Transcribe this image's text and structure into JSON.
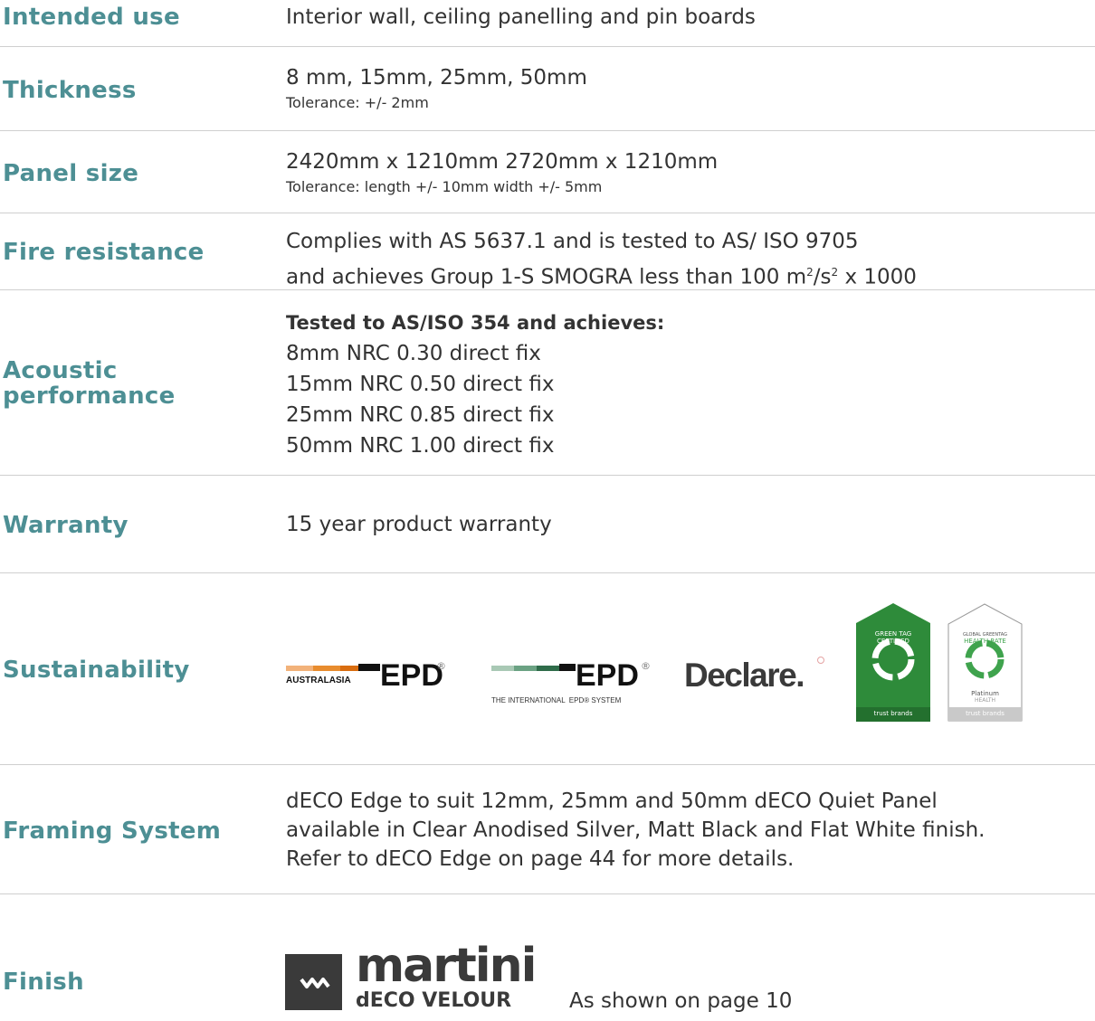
{
  "rows": {
    "intended_use": {
      "label": "Intended use",
      "value": "Interior wall, ceiling panelling and pin boards"
    },
    "thickness": {
      "label": "Thickness",
      "value": "8 mm, 15mm, 25mm, 50mm",
      "note": "Tolerance: +/- 2mm"
    },
    "panel_size": {
      "label": "Panel size",
      "value": "2420mm x 1210mm 2720mm x 1210mm",
      "note": "Tolerance: length +/- 10mm width +/- 5mm"
    },
    "fire": {
      "label": "Fire resistance",
      "line1": "Complies with AS 5637.1 and is tested to AS/ ISO 9705",
      "line2a": "and achieves Group 1-S SMOGRA less than 100 m",
      "sup1": "2",
      "line2b": "/s",
      "sup2": "2",
      "line2c": " x 1000"
    },
    "acoustic": {
      "label1": "Acoustic",
      "label2": "performance",
      "heading": "Tested to AS/ISO 354 and achieves:",
      "items": [
        "8mm NRC 0.30 direct fix",
        "15mm NRC 0.50 direct fix",
        "25mm NRC 0.85 direct fix",
        "50mm NRC 1.00 direct fix"
      ]
    },
    "warranty": {
      "label": "Warranty",
      "value": "15 year product warranty"
    },
    "sustainability": {
      "label": "Sustainability"
    },
    "framing": {
      "label": "Framing System",
      "lines": [
        "dECO Edge to suit 12mm, 25mm and 50mm dECO Quiet Panel",
        "available in Clear Anodised Silver, Matt Black and Flat White finish.",
        "Refer to dECO Edge on page 44 for more details."
      ]
    },
    "finish": {
      "label": "Finish",
      "note": "As shown on page 10"
    }
  },
  "logos": {
    "epd_au": {
      "region": "AUSTRALASIA",
      "text": "EPD",
      "mark": "®"
    },
    "epd_intl": {
      "text": "EPD",
      "mark": "®",
      "sub": "THE INTERNATIONAL  EPD® SYSTEM"
    },
    "declare": {
      "text": "Declare."
    },
    "green_tag": {
      "top": "GREEN TAG",
      "mid": "CERTIFIED",
      "footer": "trust brands"
    },
    "health_rate": {
      "top": "GLOBAL GREENTAG",
      "mid": "HEALTH RATE",
      "level": "Platinum",
      "level2": "HEALTH",
      "footer": "trust brands"
    },
    "martini": {
      "brand": "martini",
      "product": "dECO VELOUR"
    }
  },
  "colors": {
    "label": "#4d8f94",
    "text": "#333333",
    "divider": "#cfcfcf",
    "green": "#2e8b3a"
  }
}
